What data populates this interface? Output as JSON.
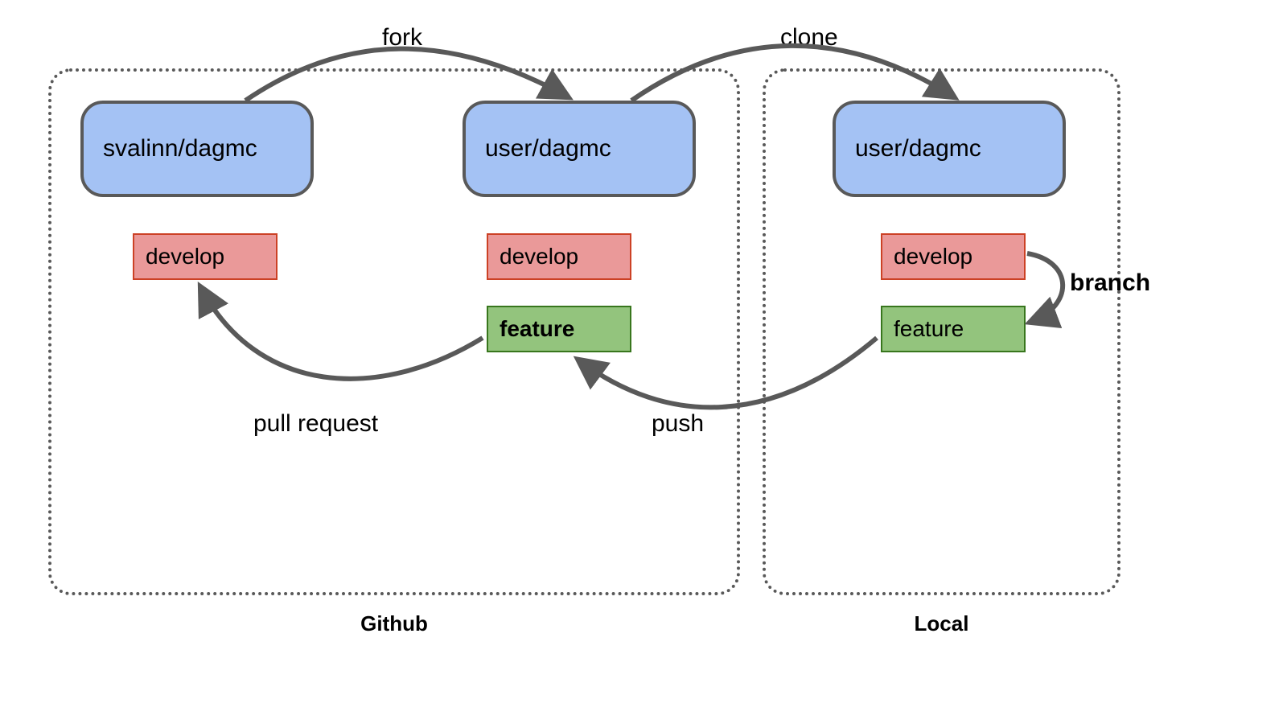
{
  "regions": {
    "github_label": "Github",
    "local_label": "Local"
  },
  "repos": {
    "upstream": "svalinn/dagmc",
    "fork": "user/dagmc",
    "local": "user/dagmc"
  },
  "branches": {
    "upstream_develop": "develop",
    "fork_develop": "develop",
    "fork_feature": "feature",
    "local_develop": "develop",
    "local_feature": "feature"
  },
  "edges": {
    "fork": "fork",
    "clone": "clone",
    "branch": "branch",
    "push": "push",
    "pull_request": "pull request"
  },
  "colors": {
    "box_stroke": "#595959",
    "arrow": "#595959",
    "repo_fill": "#a4c2f4",
    "develop_fill": "#ea9999",
    "develop_stroke": "#cc4125",
    "feature_fill": "#93c47d",
    "feature_stroke": "#38761d"
  }
}
